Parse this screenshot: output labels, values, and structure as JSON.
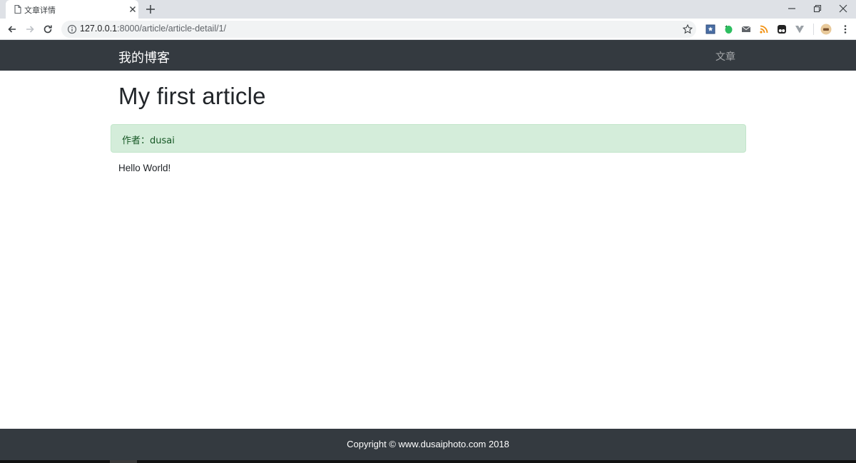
{
  "browser": {
    "tab": {
      "title": "文章详情"
    },
    "url": {
      "host": "127.0.0.1",
      "path": ":8000/article/article-detail/1/"
    },
    "icons": [
      "page-icon",
      "close-icon",
      "plus-icon",
      "minimize-icon",
      "restore-icon",
      "window-close-icon",
      "back-icon",
      "forward-icon",
      "reload-icon",
      "info-icon",
      "star-icon",
      "bookmark-ext-icon",
      "evernote-ext-icon",
      "mail-ext-icon",
      "rss-ext-icon",
      "tampermonkey-ext-icon",
      "vue-devtools-ext-icon",
      "profile-avatar",
      "menu-kebab-icon"
    ]
  },
  "navbar": {
    "brand": "我的博客",
    "link": "文章"
  },
  "article": {
    "title": "My first article",
    "author": "作者：dusai",
    "body": "Hello World!"
  },
  "footer": {
    "copyright": "Copyright © www.dusaiphoto.com 2018"
  },
  "colors": {
    "navbar_bg": "#343a40",
    "alert_bg": "#d4edda",
    "alert_text": "#155724",
    "tabstrip_bg": "#dee1e6"
  }
}
